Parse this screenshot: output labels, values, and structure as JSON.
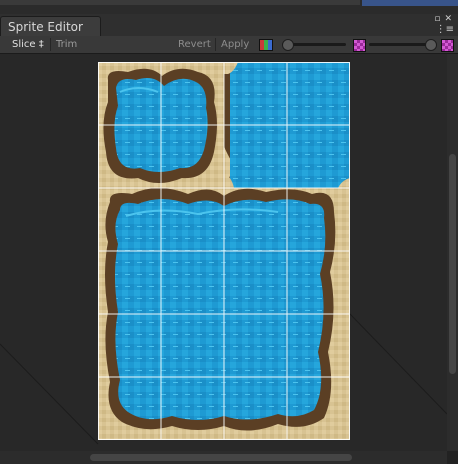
{
  "window": {
    "tab_title": "Sprite Editor"
  },
  "toolbar": {
    "slice_label": "Slice ‡",
    "trim_label": "Trim",
    "revert_label": "Revert",
    "apply_label": "Apply",
    "mip_slider_level": 0.0,
    "zoom_slider_level": 1.0
  },
  "colors": {
    "sand": "#d9c596",
    "water": "#1f9fd6",
    "water_light": "#46c2ec",
    "shore_dark": "#5b3f24",
    "grid": "#ffffff"
  },
  "icons": {
    "maximize": "maximize-icon",
    "close": "close-icon",
    "menu": "window-menu-icon",
    "color_channel": "color-channel-icon",
    "zoom_checker": "zoom-checker-icon"
  }
}
